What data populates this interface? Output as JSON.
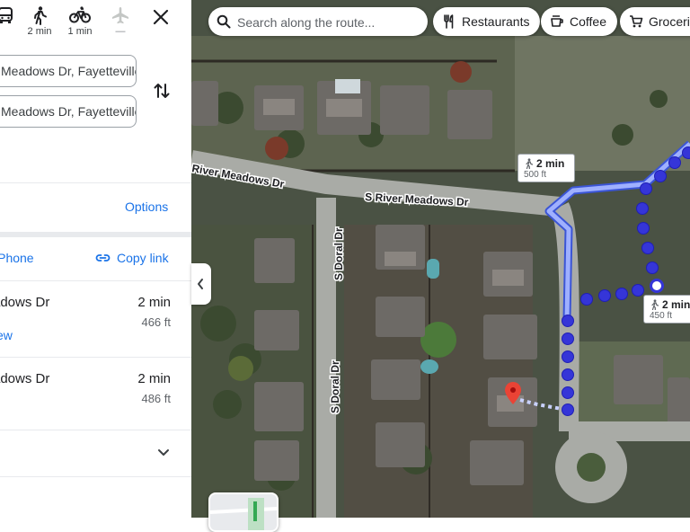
{
  "travel_modes": [
    {
      "name": "transit",
      "time": ""
    },
    {
      "name": "walking",
      "time": "2 min"
    },
    {
      "name": "cycling",
      "time": "1 min"
    },
    {
      "name": "flight",
      "time": "—"
    }
  ],
  "directions": {
    "origin_value": "Meadows Dr, Fayetteville, AR",
    "destination_value": "Meadows Dr, Fayetteville, AR"
  },
  "options_label": "Options",
  "share": {
    "send_label": "iPhone",
    "copy_label": "Copy link"
  },
  "routes": [
    {
      "name": "adows Dr",
      "time": "2 min",
      "distance": "466 ft",
      "link": "ew"
    },
    {
      "name": "adows Dr",
      "time": "2 min",
      "distance": "486 ft"
    }
  ],
  "map": {
    "search_placeholder": "Search along the route...",
    "chips": [
      "Restaurants",
      "Coffee",
      "Groceries"
    ],
    "street_labels": [
      "River Meadows Dr",
      "S River Meadows Dr",
      "S Doral Dr",
      "S Doral Dr"
    ],
    "callouts": [
      {
        "time": "2 min",
        "distance": "500 ft"
      },
      {
        "time": "2 min",
        "distance": "450 ft"
      }
    ]
  },
  "colors": {
    "accent": "#1a73e8",
    "route_line": "#4c6ef5",
    "route_dots": "#3d3ddf",
    "pin": "#ea4335"
  }
}
